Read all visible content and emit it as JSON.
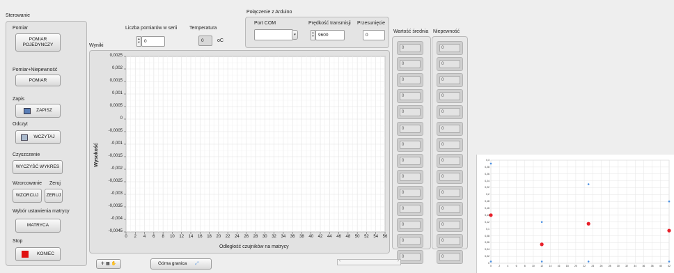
{
  "labels": {
    "sterowanie": "Sterowanie",
    "wyniki": "Wyniki",
    "connection": "Połączenie z Arduino",
    "wartosc_srednia": "Wartość średnia",
    "niepewnosc": "Niepewność"
  },
  "sidebar": {
    "pomiar_label": "Pomiar",
    "pomiar_button": "POMIAR POJEDYNCZY",
    "pomiar_niep_label": "Pomiar+Niepewność",
    "pomiar_niep_button": "POMIAR",
    "zapis_label": "Zapis",
    "zapis_button": "ZAPISZ",
    "odczyt_label": "Odczyt",
    "odczyt_button": "WCZYTAJ",
    "czyszczenie_label": "Czyszczenie",
    "czyszczenie_button": "WYCZYŚĆ WYKRES",
    "wzorcowanie_label": "Wzorcowanie",
    "zeruj_label": "Zeruj",
    "wzorcuj_button": "WZORCUJ",
    "zeruj_button": "ZERUJ",
    "matryca_label": "Wybór ustawienia matrycy",
    "matryca_button": "MATRYCA",
    "stop_label": "Stop",
    "stop_button": "KONIEC",
    "stop_color": "#e01010"
  },
  "controls": {
    "liczba_label": "Liczba pomiarów w serii",
    "liczba_value": "0",
    "temperatura_label": "Temperatura",
    "temperatura_value": "0",
    "temperatura_unit": "oC",
    "port_label": "Port COM",
    "port_value": "",
    "predkosc_label": "Prędkość transmisji",
    "predkosc_value": "9600",
    "przesuniecie_label": "Przesunięcie",
    "przesuniecie_value": "0"
  },
  "results": {
    "wartosc": [
      "0",
      "0",
      "0",
      "0",
      "0",
      "0",
      "0",
      "0",
      "0",
      "0",
      "0",
      "0",
      "0",
      "0"
    ],
    "niepewnosc": [
      "0",
      "0",
      "0",
      "0",
      "0",
      "0",
      "0",
      "0",
      "0",
      "0",
      "0",
      "0",
      "0",
      "0"
    ]
  },
  "bottom": {
    "gorna_granica": "Górna granica"
  },
  "chart_data": [
    {
      "type": "scatter",
      "xlabel": "Odległość czujników na matrycy",
      "ylabel": "Wysokość",
      "ylim": [
        -0.0045,
        0.0025
      ],
      "xlim": [
        0,
        56
      ],
      "y_ticks": [
        "0,0025",
        "0,002",
        "0,0015",
        "0,001",
        "0,0005",
        "0",
        "-0,0005",
        "-0,001",
        "-0,0015",
        "-0,002",
        "-0,0025",
        "-0,003",
        "-0,0035",
        "-0,004",
        "-0,0045"
      ],
      "x_ticks": [
        "0",
        "2",
        "4",
        "6",
        "8",
        "10",
        "12",
        "14",
        "16",
        "18",
        "20",
        "22",
        "24",
        "26",
        "28",
        "30",
        "32",
        "34",
        "36",
        "38",
        "40",
        "42",
        "44",
        "46",
        "48",
        "50",
        "52",
        "54",
        "56"
      ],
      "grid": true,
      "series": []
    },
    {
      "type": "scatter",
      "ylim": [
        0,
        0.3
      ],
      "xlim": [
        0,
        42
      ],
      "y_ticks": [
        "0,3",
        "0,28",
        "0,26",
        "0,24",
        "0,22",
        "0,2",
        "0,18",
        "0,16",
        "0,14",
        "0,12",
        "0,1",
        "0,08",
        "0,06",
        "0,04",
        "0,02",
        "0"
      ],
      "x_ticks": [
        "0",
        "2",
        "4",
        "6",
        "8",
        "10",
        "12",
        "14",
        "16",
        "18",
        "20",
        "22",
        "24",
        "26",
        "28",
        "30",
        "32",
        "34",
        "36",
        "38",
        "40",
        "42"
      ],
      "grid": true,
      "series": [
        {
          "color": "#e8202a",
          "points": [
            [
              0,
              0.14
            ],
            [
              12,
              0.055
            ],
            [
              23,
              0.115
            ],
            [
              42,
              0.095
            ]
          ]
        },
        {
          "color": "#4a90e2",
          "points": [
            [
              0,
              0.29
            ],
            [
              0,
              0.005
            ],
            [
              12,
              0.12
            ],
            [
              12,
              0.005
            ],
            [
              23,
              0.23
            ],
            [
              23,
              0.005
            ],
            [
              42,
              0.18
            ],
            [
              42,
              0.005
            ]
          ]
        }
      ]
    }
  ]
}
